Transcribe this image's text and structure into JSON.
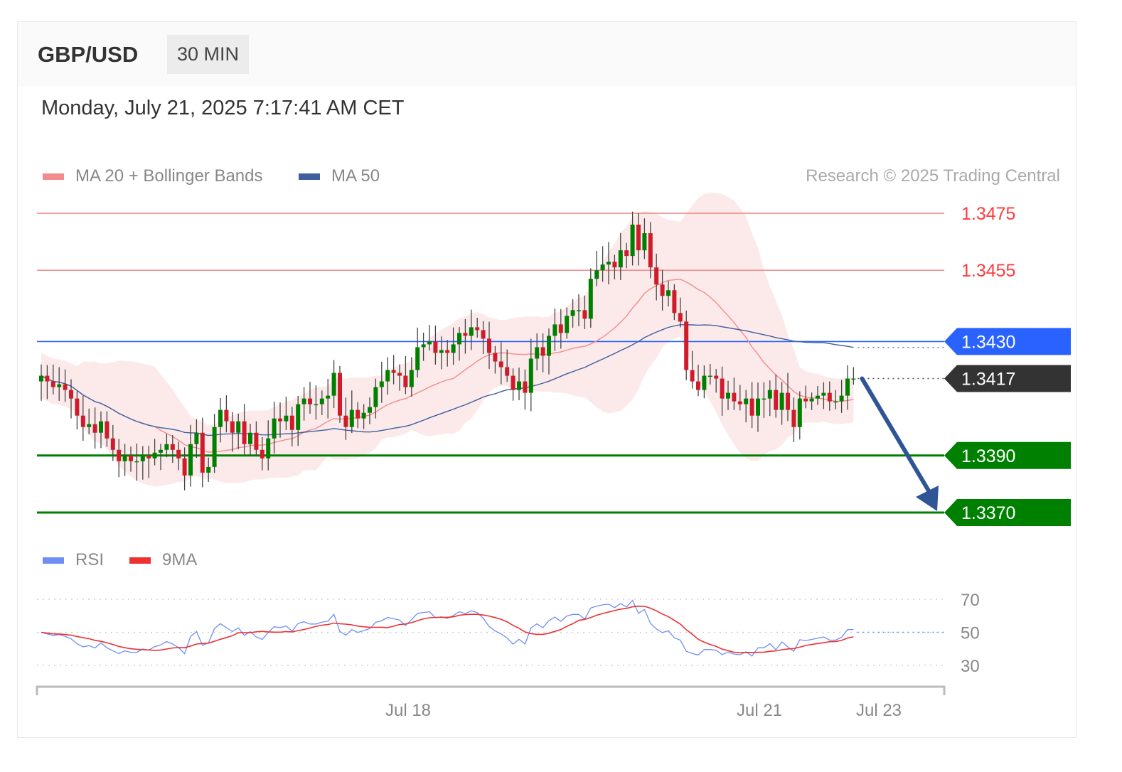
{
  "header": {
    "symbol": "GBP/USD",
    "timeframe": "30 MIN"
  },
  "datetime": "Monday, July 21, 2025 7:17:41 AM CET",
  "legend": {
    "ma20_label": "MA 20 + Bollinger Bands",
    "ma50_label": "MA 50",
    "credit": "Research © 2025 Trading Central",
    "rsi_label": "RSI",
    "rsi_ma_label": "9MA"
  },
  "colors": {
    "ma20": "#f28b8b",
    "ma50": "#3d5f9e",
    "resistance": "#ff3b3b",
    "pivot": "#2962ff",
    "support": "#008000",
    "current": "#333333",
    "rsi": "#6f8ef5",
    "rsi_ma": "#ee3030",
    "arrow": "#2f5597",
    "bull": "#008000",
    "bear": "#d01c2a"
  },
  "chart_data": {
    "type": "candlestick",
    "title": "GBP/USD",
    "timeframe": "30 MIN",
    "x_ticks": [
      "Jul 18",
      "Jul 21",
      "Jul 23"
    ],
    "ylim": [
      1.3366,
      1.3478
    ],
    "levels": [
      {
        "name": "resistance-2",
        "value": 1.3475,
        "label": "1.3475"
      },
      {
        "name": "resistance-1",
        "value": 1.3455,
        "label": "1.3455"
      },
      {
        "name": "pivot",
        "value": 1.343,
        "label": "1.3430"
      },
      {
        "name": "current",
        "value": 1.3417,
        "label": "1.3417"
      },
      {
        "name": "support-1",
        "value": 1.339,
        "label": "1.3390"
      },
      {
        "name": "support-2",
        "value": 1.337,
        "label": "1.3370"
      }
    ],
    "closes": [
      1.3418,
      1.3416,
      1.3414,
      1.3415,
      1.3413,
      1.341,
      1.3404,
      1.34,
      1.3401,
      1.3398,
      1.3402,
      1.3396,
      1.3392,
      1.3388,
      1.339,
      1.3388,
      1.3388,
      1.339,
      1.3389,
      1.3391,
      1.3392,
      1.3394,
      1.3392,
      1.3389,
      1.3383,
      1.3394,
      1.3398,
      1.3384,
      1.3386,
      1.34,
      1.3406,
      1.3402,
      1.3398,
      1.3402,
      1.3394,
      1.3398,
      1.3392,
      1.3389,
      1.3396,
      1.3403,
      1.3402,
      1.3404,
      1.3399,
      1.3408,
      1.341,
      1.3408,
      1.3408,
      1.341,
      1.3411,
      1.3419,
      1.3404,
      1.34,
      1.3406,
      1.3403,
      1.3405,
      1.3407,
      1.3414,
      1.3416,
      1.342,
      1.3419,
      1.3418,
      1.3414,
      1.342,
      1.3428,
      1.3429,
      1.343,
      1.3426,
      1.3427,
      1.3426,
      1.3429,
      1.3433,
      1.3432,
      1.3435,
      1.3434,
      1.3431,
      1.3426,
      1.3423,
      1.3421,
      1.3418,
      1.3413,
      1.3416,
      1.3412,
      1.3424,
      1.3428,
      1.3425,
      1.3432,
      1.3436,
      1.3433,
      1.3439,
      1.3441,
      1.3441,
      1.3438,
      1.3452,
      1.3455,
      1.3457,
      1.3458,
      1.3456,
      1.3462,
      1.346,
      1.3471,
      1.3462,
      1.3468,
      1.3456,
      1.345,
      1.3446,
      1.3448,
      1.344,
      1.3437,
      1.342,
      1.3416,
      1.3413,
      1.3418,
      1.3418,
      1.3417,
      1.341,
      1.3412,
      1.3409,
      1.3408,
      1.341,
      1.3404,
      1.341,
      1.341,
      1.3413,
      1.3406,
      1.3412,
      1.3406,
      1.34,
      1.341,
      1.3409,
      1.341,
      1.3411,
      1.3412,
      1.3409,
      1.3409,
      1.3411,
      1.3417,
      1.3417
    ],
    "rsi": {
      "ticks": [
        70,
        50,
        30
      ],
      "last": 50
    }
  }
}
